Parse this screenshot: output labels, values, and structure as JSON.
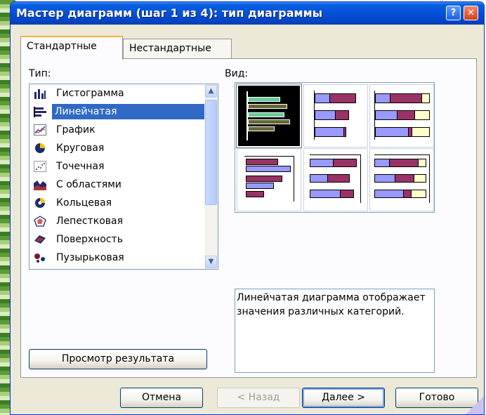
{
  "window": {
    "title": "Мастер диаграмм (шаг 1 из 4): тип диаграммы",
    "help_label": "?",
    "close_label": "✕"
  },
  "tabs": [
    {
      "label": "Стандартные",
      "active": true
    },
    {
      "label": "Нестандартные",
      "active": false
    }
  ],
  "type_section": {
    "label": "Тип:",
    "items": [
      {
        "label": "Гистограмма",
        "icon": "column-chart-icon"
      },
      {
        "label": "Линейчатая",
        "icon": "bar-chart-icon",
        "selected": true
      },
      {
        "label": "График",
        "icon": "line-chart-icon"
      },
      {
        "label": "Круговая",
        "icon": "pie-chart-icon"
      },
      {
        "label": "Точечная",
        "icon": "scatter-chart-icon"
      },
      {
        "label": "С областями",
        "icon": "area-chart-icon"
      },
      {
        "label": "Кольцевая",
        "icon": "doughnut-chart-icon"
      },
      {
        "label": "Лепестковая",
        "icon": "radar-chart-icon"
      },
      {
        "label": "Поверхность",
        "icon": "surface-chart-icon"
      },
      {
        "label": "Пузырьковая",
        "icon": "bubble-chart-icon"
      }
    ],
    "scroll_up": "▲",
    "scroll_down": "▼"
  },
  "view_section": {
    "label": "Вид:"
  },
  "description": "Линейчатая диаграмма отображает значения различных категорий.",
  "preview_button": "Просмотр результата",
  "buttons": {
    "cancel": "Отмена",
    "back": "< Назад",
    "next": "Далее >",
    "finish": "Готово"
  },
  "colors": {
    "title_blue": "#0450d8",
    "selection": "#316ac5",
    "bar_purple": "#993366",
    "bar_blue": "#9999ff",
    "bar_cream": "#ffffcc",
    "bar_green": "#66cc99",
    "bar_olive": "#666633"
  }
}
